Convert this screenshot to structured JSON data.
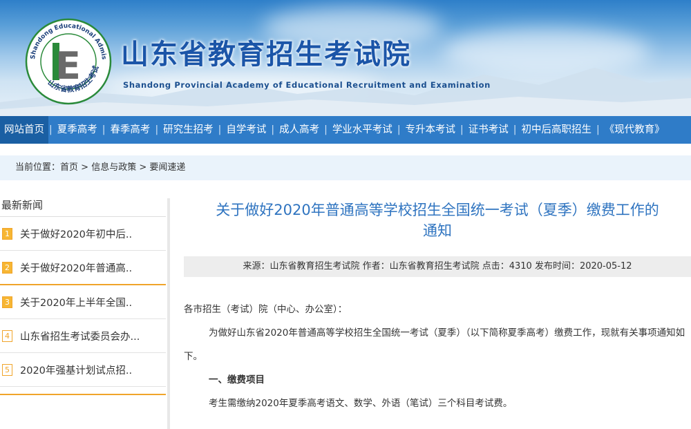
{
  "header": {
    "logo_ring_text": "Shandong Educational Admission & Examinations",
    "logo_ring_cn": "山东省教育招生考试",
    "logo_letter": "E",
    "title": "山东省教育招生考试院",
    "subtitle": "Shandong Provincial Academy of Educational Recruitment and Examination"
  },
  "nav": {
    "items": [
      {
        "label": "网站首页",
        "active": true
      },
      {
        "label": "夏季高考"
      },
      {
        "label": "春季高考"
      },
      {
        "label": "研究生招考"
      },
      {
        "label": "自学考试"
      },
      {
        "label": "成人高考"
      },
      {
        "label": "学业水平考试"
      },
      {
        "label": "专升本考试"
      },
      {
        "label": "证书考试"
      },
      {
        "label": "初中后高职招生"
      },
      {
        "label": "《现代教育》"
      }
    ],
    "separator": "|"
  },
  "breadcrumb": {
    "prefix": "当前位置：",
    "items": [
      "首页",
      "信息与政策",
      "要闻速递"
    ],
    "separator": " > "
  },
  "sidebar": {
    "title": "最新新闻",
    "items": [
      {
        "num": "1",
        "text": "关于做好2020年初中后.."
      },
      {
        "num": "2",
        "text": "关于做好2020年普通高.."
      },
      {
        "num": "3",
        "text": "关于2020年上半年全国.."
      },
      {
        "num": "4",
        "text": "山东省招生考试委员会办..."
      },
      {
        "num": "5",
        "text": "2020年强基计划试点招.."
      }
    ]
  },
  "article": {
    "title_line1": "关于做好2020年普通高等学校招生全国统一考试（夏季）缴费工作的",
    "title_line2": "通知",
    "meta": "来源：山东省教育招生考试院 作者：山东省教育招生考试院 点击：4310 发布时间：2020-05-12",
    "salutation": "各市招生（考试）院（中心、办公室）：",
    "para1": "为做好山东省2020年普通高等学校招生全国统一考试（夏季）（以下简称夏季高考）缴费工作，现就有关事项通知如下。",
    "section1": "一、缴费项目",
    "para2": "考生需缴纳2020年夏季高考语文、数学、外语（笔试）三个科目考试费。"
  },
  "colors": {
    "nav_bg": "#2f7cc8",
    "nav_active": "#1a5fa3",
    "title_blue": "#2f74c0",
    "accent_orange": "#f0a42a"
  }
}
